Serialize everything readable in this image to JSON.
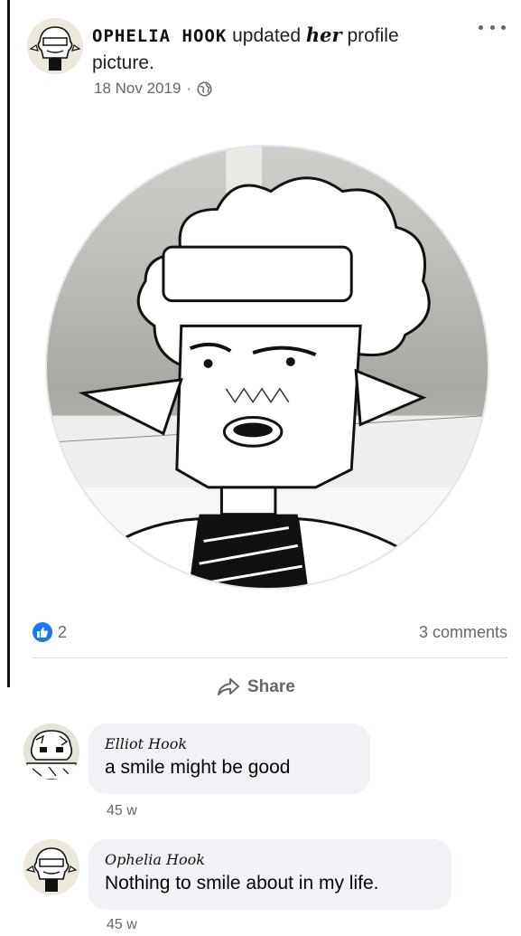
{
  "post": {
    "author_name": "OPHELIA HOOK",
    "action_text_1": "updated",
    "pronoun": "her",
    "action_text_2": "profile picture.",
    "date": "18 Nov 2019",
    "separator": "·",
    "privacy_icon": "globe-icon",
    "more_icon": "more-options-icon"
  },
  "reactions": {
    "like_icon": "like-icon",
    "like_count": "2",
    "comments_count": "3 comments"
  },
  "actions": {
    "share_label": "Share",
    "share_icon": "share-icon"
  },
  "comments": [
    {
      "author": "Elliot Hook",
      "text": "a smile might be good",
      "time": "45 w"
    },
    {
      "author": "Ophelia Hook",
      "text": "Nothing to smile about in my life.",
      "time": "45 w"
    }
  ],
  "colors": {
    "accent_blue": "#1877f2",
    "meta_gray": "#65676b",
    "bubble_bg": "#f0f2f5"
  }
}
